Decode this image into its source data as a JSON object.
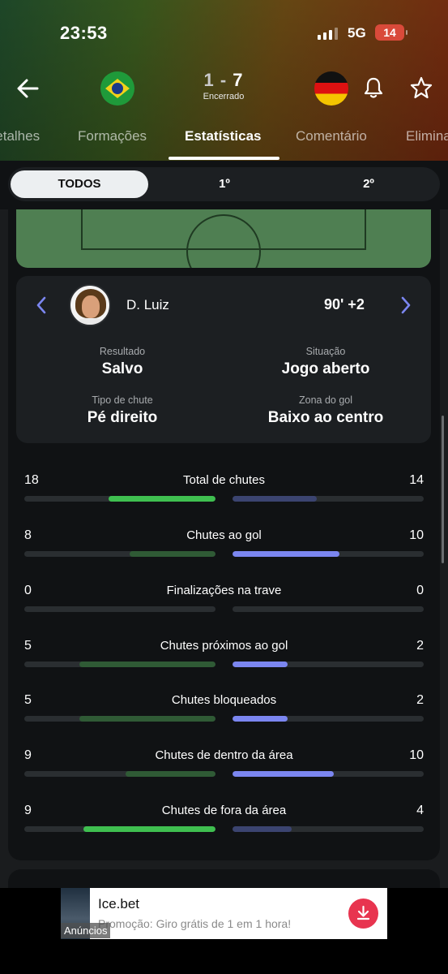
{
  "status_bar": {
    "time": "23:53",
    "network": "5G",
    "battery": "14"
  },
  "match": {
    "home_score": "1",
    "separator": "-",
    "away_score": "7",
    "status": "Encerrado"
  },
  "tabs": [
    {
      "label": "Detalhes"
    },
    {
      "label": "Formações"
    },
    {
      "label": "Estatísticas"
    },
    {
      "label": "Comentário"
    },
    {
      "label": "Eliminatórias"
    }
  ],
  "period_filter": {
    "options": [
      "TODOS",
      "1º",
      "2º"
    ],
    "selected": "TODOS"
  },
  "shot": {
    "player": "D. Luiz",
    "minute": "90' +2",
    "fields": [
      {
        "key": "Resultado",
        "value": "Salvo"
      },
      {
        "key": "Situação",
        "value": "Jogo aberto"
      },
      {
        "key": "Tipo de chute",
        "value": "Pé direito"
      },
      {
        "key": "Zona do gol",
        "value": "Baixo ao centro"
      }
    ]
  },
  "stats": [
    {
      "name": "Total de chutes",
      "home": "18",
      "away": "14",
      "home_fill": 0.56,
      "away_fill": 0.44,
      "home_color": "#3fbf50",
      "away_color": "#3b4470"
    },
    {
      "name": "Chutes ao gol",
      "home": "8",
      "away": "10",
      "home_fill": 0.45,
      "away_fill": 0.56,
      "home_color": "#2f5a35",
      "away_color": "#7b86f0"
    },
    {
      "name": "Finalizações na trave",
      "home": "0",
      "away": "0",
      "home_fill": 0,
      "away_fill": 0,
      "home_color": "#2f5a35",
      "away_color": "#3b4470"
    },
    {
      "name": "Chutes próximos ao gol",
      "home": "5",
      "away": "2",
      "home_fill": 0.71,
      "away_fill": 0.29,
      "home_color": "#2f5a35",
      "away_color": "#7b86f0"
    },
    {
      "name": "Chutes bloqueados",
      "home": "5",
      "away": "2",
      "home_fill": 0.71,
      "away_fill": 0.29,
      "home_color": "#2f5a35",
      "away_color": "#7b86f0"
    },
    {
      "name": "Chutes de dentro da área",
      "home": "9",
      "away": "10",
      "home_fill": 0.47,
      "away_fill": 0.53,
      "home_color": "#2f5a35",
      "away_color": "#7b86f0"
    },
    {
      "name": "Chutes de fora da área",
      "home": "9",
      "away": "4",
      "home_fill": 0.69,
      "away_fill": 0.31,
      "home_color": "#3fbf50",
      "away_color": "#3b4470"
    }
  ],
  "ad": {
    "title": "Ice.bet",
    "description": "Promoção: Giro grátis de 1 em 1 hora!",
    "label": "Anúncios"
  }
}
